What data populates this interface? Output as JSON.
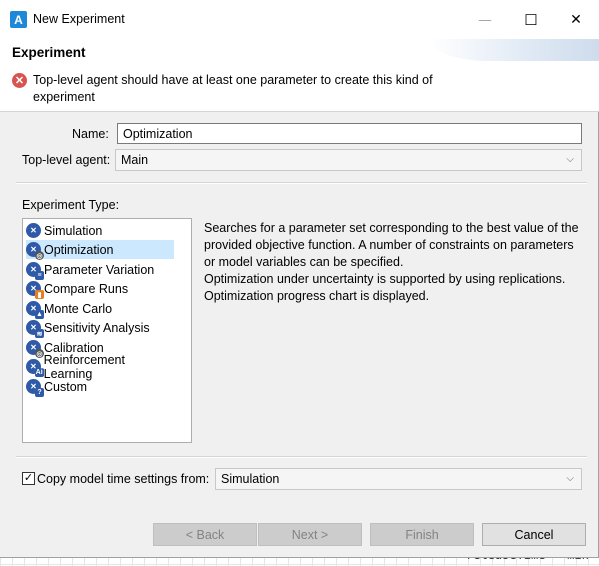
{
  "window": {
    "title": "New Experiment",
    "app_icon": "anylogic-icon",
    "minimize": "—",
    "maximize": "☐",
    "close": "✕"
  },
  "header": {
    "title": "Experiment",
    "error_icon": "error-icon",
    "error_message": "Top-level agent should have at least one parameter to create this kind of experiment"
  },
  "form": {
    "name_label": "Name:",
    "name_value": "Optimization",
    "agent_label": "Top-level agent:",
    "agent_value": "Main"
  },
  "experiment_type": {
    "label": "Experiment Type:",
    "items": [
      {
        "label": "Simulation",
        "icon": "simulation-icon",
        "selected": false
      },
      {
        "label": "Optimization",
        "icon": "optimization-icon",
        "selected": true
      },
      {
        "label": "Parameter Variation",
        "icon": "parameter-variation-icon",
        "selected": false
      },
      {
        "label": "Compare Runs",
        "icon": "compare-runs-icon",
        "selected": false
      },
      {
        "label": "Monte Carlo",
        "icon": "monte-carlo-icon",
        "selected": false
      },
      {
        "label": "Sensitivity Analysis",
        "icon": "sensitivity-analysis-icon",
        "selected": false
      },
      {
        "label": "Calibration",
        "icon": "calibration-icon",
        "selected": false
      },
      {
        "label": "Reinforcement Learning",
        "icon": "reinforcement-learning-icon",
        "selected": false
      },
      {
        "label": "Custom",
        "icon": "custom-icon",
        "selected": false
      }
    ],
    "description": [
      "Searches for a parameter set corresponding to the best value of the provided objective function. A number of constraints on parameters or model variables can be specified.",
      "Optimization under uncertainty is supported by using replications.",
      "Optimization progress chart is displayed."
    ]
  },
  "copy_settings": {
    "checked": true,
    "label": "Copy model time settings from:",
    "value": "Simulation"
  },
  "buttons": {
    "back": "< Back",
    "next": "Next >",
    "finish": "Finish",
    "cancel": "Cancel"
  },
  "background_code": "releaseTime = min"
}
